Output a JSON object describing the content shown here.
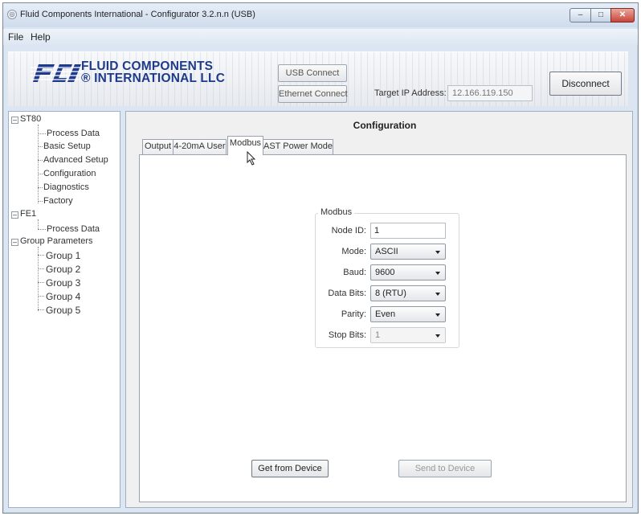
{
  "window": {
    "title": "Fluid Components International - Configurator 3.2.n.n (USB)",
    "controls": {
      "minimize": "–",
      "maximize": "□",
      "close": "✕"
    }
  },
  "menu": [
    "File",
    "Help"
  ],
  "header": {
    "logo_mark": "FCI",
    "logo_line1": "FLUID COMPONENTS",
    "logo_line2": "® INTERNATIONAL LLC",
    "usb_connect": "USB Connect",
    "ethernet_connect": "Ethernet Connect",
    "target_ip_label": "Target IP Address:",
    "target_ip_value": "12.166.119.150",
    "disconnect": "Disconnect"
  },
  "tree": {
    "st80": {
      "label": "ST80",
      "children": [
        "Process Data",
        "Basic Setup",
        "Advanced Setup",
        "Configuration",
        "Diagnostics",
        "Factory"
      ]
    },
    "fe1": {
      "label": "FE1",
      "children": [
        "Process Data"
      ]
    },
    "group_params": {
      "label": "Group Parameters",
      "children": [
        "Group 1",
        "Group 2",
        "Group 3",
        "Group 4",
        "Group 5"
      ]
    }
  },
  "config": {
    "title": "Configuration",
    "tabs": [
      "Output",
      "4-20mA User",
      "Modbus",
      "AST Power Mode"
    ],
    "active_tab": "Modbus",
    "modbus": {
      "group_title": "Modbus",
      "node_id_label": "Node ID:",
      "node_id_value": "1",
      "mode_label": "Mode:",
      "mode_value": "ASCII",
      "baud_label": "Baud:",
      "baud_value": "9600",
      "data_bits_label": "Data Bits:",
      "data_bits_value": "8 (RTU)",
      "parity_label": "Parity:",
      "parity_value": "Even",
      "stop_bits_label": "Stop Bits:",
      "stop_bits_value": "1"
    },
    "get_from_device": "Get from Device",
    "send_to_device": "Send to Device"
  },
  "colors": {
    "logo_blue": "#1e3a8a",
    "window_frame": "#dce6f2",
    "close_red": "#c9453a"
  }
}
